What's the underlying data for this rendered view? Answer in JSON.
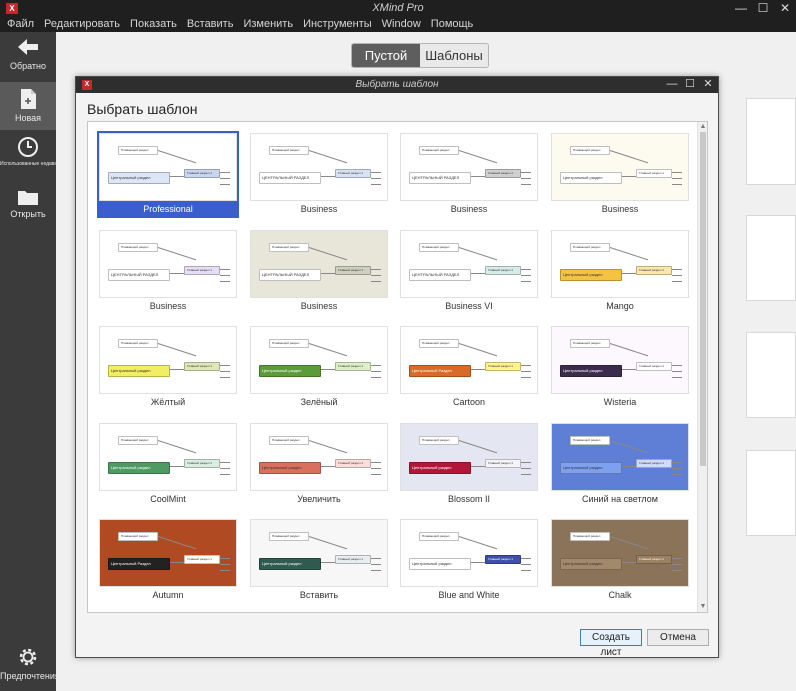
{
  "window": {
    "title": "XMind Pro",
    "logo": "X",
    "minimize": "—",
    "maximize": "☐",
    "close": "✕"
  },
  "menu": [
    "Файл",
    "Редактировать",
    "Показать",
    "Вставить",
    "Изменить",
    "Инструменты",
    "Window",
    "Помощь"
  ],
  "sidebar": {
    "back": "Обратно",
    "new": "Новая",
    "recent": "Использованные недавно",
    "open": "Открыть",
    "prefs": "Предпочтения"
  },
  "segmented": {
    "blank": "Пустой",
    "templates": "Шаблоны"
  },
  "dialog": {
    "title": "Выбрать шаблон",
    "heading": "Выбрать шаблон",
    "create_button": "Создать лист",
    "cancel_button": "Отмена",
    "scroll_up": "▲",
    "scroll_down": "▼"
  },
  "templates": [
    {
      "label": "Professional",
      "selected": true,
      "bg": "#ffffff",
      "central": "#dde6f7",
      "main": "#c9d6f0",
      "ctext": "Центральный раздел",
      "mtext": "Главный раздел 1",
      "ftext": "Плавающий раздел"
    },
    {
      "label": "Business",
      "selected": false,
      "bg": "#ffffff",
      "central": "#ffffff",
      "main": "#d7e3f5",
      "ctext": "ЦЕНТРАЛЬНЫЙ РАЗДЕЛ",
      "mtext": "Главный раздел 1",
      "ftext": "Плавающий раздел"
    },
    {
      "label": "Business",
      "selected": false,
      "bg": "#ffffff",
      "central": "#ffffff",
      "main": "#cfcfcf",
      "ctext": "ЦЕНТРАЛЬНЫЙ РАЗДЕЛ",
      "mtext": "Главный раздел 1",
      "ftext": "Плавающий раздел"
    },
    {
      "label": "Business",
      "selected": false,
      "bg": "#fdfaf0",
      "central": "#ffffff",
      "main": "#ffffff",
      "ctext": "Центральный раздел",
      "mtext": "Главный раздел 1",
      "ftext": "Плавающий раздел"
    },
    {
      "label": "Business",
      "selected": false,
      "bg": "#ffffff",
      "central": "#ffffff",
      "main": "#e6def5",
      "ctext": "ЦЕНТРАЛЬНЫЙ РАЗДЕЛ",
      "mtext": "Главный раздел 1",
      "ftext": "Плавающий раздел"
    },
    {
      "label": "Business",
      "selected": false,
      "bg": "#e8e6d8",
      "central": "#ffffff",
      "main": "#cfcfc0",
      "ctext": "ЦЕНТРАЛЬНЫЙ РАЗДЕЛ",
      "mtext": "Главный раздел 1",
      "ftext": "Плавающий раздел"
    },
    {
      "label": "Business VI",
      "selected": false,
      "bg": "#ffffff",
      "central": "#ffffff",
      "main": "#d6ece8",
      "ctext": "ЦЕНТРАЛЬНЫЙ РАЗДЕЛ",
      "mtext": "Главный раздел 1",
      "ftext": "Плавающий раздел"
    },
    {
      "label": "Mango",
      "selected": false,
      "bg": "#ffffff",
      "central": "#f5c342",
      "main": "#fbe7a8",
      "ctext": "Центральный раздел",
      "mtext": "Главный раздел 1",
      "ftext": "Плавающий раздел"
    },
    {
      "label": "Жёлтый",
      "selected": false,
      "bg": "#ffffff",
      "central": "#f2ee62",
      "main": "#dfe7b8",
      "ctext": "Центральный раздел",
      "mtext": "Главный раздел 1",
      "ftext": "Плавающий раздел"
    },
    {
      "label": "Зелёный",
      "selected": false,
      "bg": "#ffffff",
      "central": "#5b9b3a",
      "main": "#dcefc9",
      "ctext": "Центральный раздел",
      "mtext": "Главный раздел 1",
      "ftext": "Плавающий раздел"
    },
    {
      "label": "Cartoon",
      "selected": false,
      "bg": "#ffffff",
      "central": "#d96a28",
      "main": "#fff38a",
      "ctext": "Центральный Раздел",
      "mtext": "Главный раздел 1",
      "ftext": "Плавающий раздел"
    },
    {
      "label": "Wisteria",
      "selected": false,
      "bg": "#fcf8fd",
      "central": "#3d2b4d",
      "main": "#ffffff",
      "ctext": "Центральный раздел",
      "mtext": "Главный раздел 1",
      "ftext": "Плавающий раздел"
    },
    {
      "label": "CoolMint",
      "selected": false,
      "bg": "#ffffff",
      "central": "#4e9a62",
      "main": "#d8eee0",
      "ctext": "Центральный раздел",
      "mtext": "Главный раздел 1",
      "ftext": "Плавающий раздел"
    },
    {
      "label": "Увеличить",
      "selected": false,
      "bg": "#ffffff",
      "central": "#d9705e",
      "main": "#f9dedb",
      "ctext": "Центральный раздел",
      "mtext": "Главный раздел 1",
      "ftext": "Плавающий раздел"
    },
    {
      "label": "Blossom II",
      "selected": false,
      "bg": "#e4e6f2",
      "central": "#b2173a",
      "main": "#f4f4f8",
      "ctext": "Центральный раздел",
      "mtext": "Главный раздел 1",
      "ftext": "Плавающий раздел"
    },
    {
      "label": "Синий на светлом",
      "selected": false,
      "bg": "#5f7fd6",
      "central": "#7fa0ee",
      "main": "#cfdcf8",
      "ctext": "Центральный раздел",
      "mtext": "Главный раздел 1",
      "ftext": "Плавающий раздел"
    },
    {
      "label": "Autumn",
      "selected": false,
      "bg": "#b04a22",
      "central": "#222222",
      "main": "#ffffff",
      "ctext": "Центральный Раздел",
      "mtext": "Главный раздел 1",
      "ftext": "Плавающий раздел"
    },
    {
      "label": "Вставить",
      "selected": false,
      "bg": "#f7f7f7",
      "central": "#2f5b4e",
      "main": "#e8eef0",
      "ctext": "Центральный раздел",
      "mtext": "Главный раздел 1",
      "ftext": "Плавающий раздел"
    },
    {
      "label": "Blue and White",
      "selected": false,
      "bg": "#ffffff",
      "central": "#ffffff",
      "main": "#3f4fa8",
      "ctext": "Центральный раздел",
      "mtext": "Главный раздел 1",
      "ftext": "Плавающий раздел"
    },
    {
      "label": "Chalk",
      "selected": false,
      "bg": "#8a7358",
      "central": "#a3896b",
      "main": "#9a8163",
      "ctext": "Центральный раздел",
      "mtext": "Главный раздел 1",
      "ftext": "Плавающий раздел"
    }
  ],
  "colors": {
    "accent_selected": "#3a5fcd",
    "brand_red": "#c8252c",
    "chrome_dark": "#1f1f1f",
    "sidebar": "#3b3b3b"
  }
}
